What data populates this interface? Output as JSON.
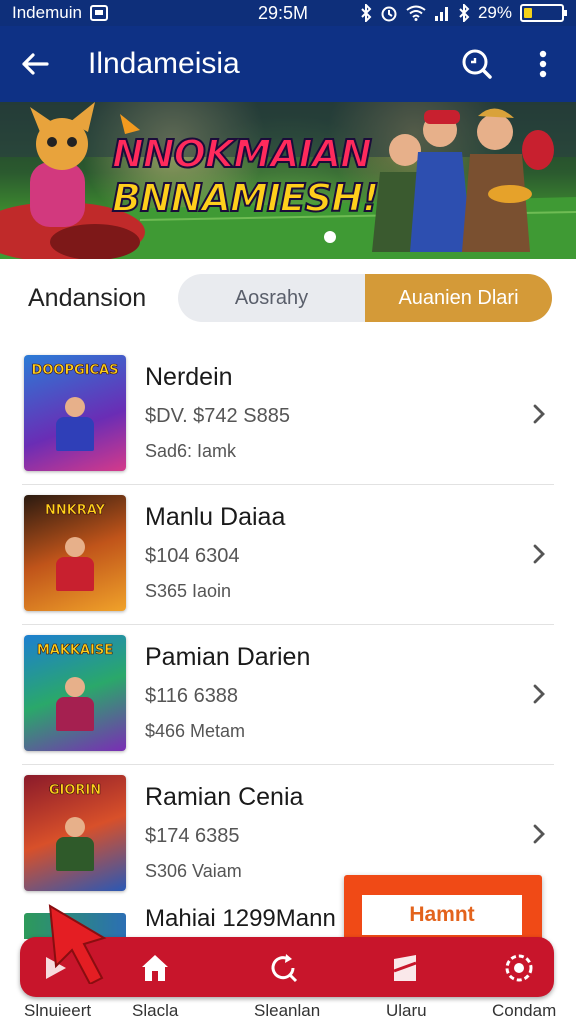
{
  "status_bar": {
    "carrier": "Indemuin",
    "time": "29:5M",
    "battery_pct": "29%",
    "battery_level": 0.29
  },
  "app_bar": {
    "title": "Ilndameisia",
    "icons": [
      "back-arrow-icon",
      "search-icon",
      "more-vert-icon"
    ]
  },
  "banner": {
    "line1": "NNOKMAIAN",
    "line2": "BNNAMIESH!"
  },
  "segment": {
    "label": "Andansion",
    "options": [
      "Aosrahy",
      "Auanien Dlari"
    ],
    "selected": 1
  },
  "list": {
    "items": [
      {
        "thumb_title": "DOOPGICAS",
        "name": "Nerdein",
        "price": "$DV. $742 S885",
        "meta": "Sad6: Iamk"
      },
      {
        "thumb_title": "NNKRAY",
        "name": "Manlu Daiaa",
        "price": "$104 6304",
        "meta": "S365 Iaoin"
      },
      {
        "thumb_title": "MAKKAISE",
        "name": "Pamian Darien",
        "price": "$116 6388",
        "meta": "$466 Metam"
      },
      {
        "thumb_title": "GIORIN",
        "name": "Ramian Cenia",
        "price": "$174 6385",
        "meta": "S306 Vaiam"
      }
    ],
    "partial_item": "Mahiai 1299Mann"
  },
  "action": {
    "button_label": "Hamnt"
  },
  "bottom_nav": {
    "labels": [
      "Slnuieert",
      "Slacla",
      "Sleanlan",
      "Ularu",
      "Condam"
    ],
    "icons": [
      "play-icon",
      "home-icon",
      "refresh-search-icon",
      "bookmark-icon",
      "settings-icon"
    ]
  },
  "colors": {
    "primary": "#0e3185",
    "accent": "#d49a38",
    "nav": "#c8152b",
    "action": "#f04a16"
  }
}
